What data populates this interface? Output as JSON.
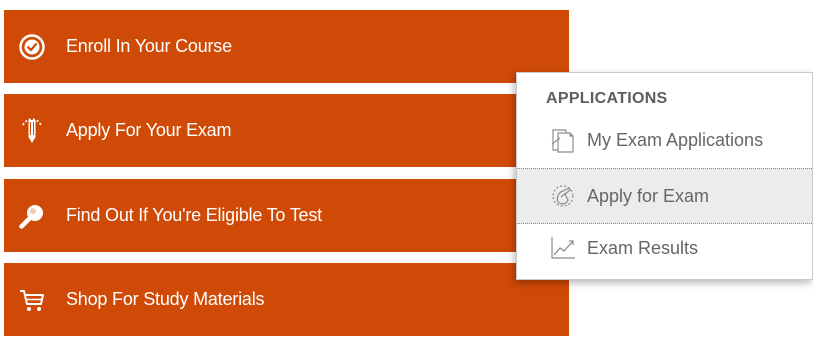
{
  "colors": {
    "button_bg": "#cf4a07",
    "button_text": "#ffffff",
    "menu_text": "#666666",
    "menu_heading": "#5e5e5e",
    "menu_hover_bg": "#ececec"
  },
  "actions": [
    {
      "label": "Enroll In Your Course",
      "icon": "check-circle-icon"
    },
    {
      "label": "Apply For Your Exam",
      "icon": "pencil-icon"
    },
    {
      "label": "Find Out If You're Eligible To Test",
      "icon": "magnifier-icon"
    },
    {
      "label": "Shop For Study Materials",
      "icon": "shopping-cart-icon"
    }
  ],
  "menu": {
    "heading": "APPLICATIONS",
    "items": [
      {
        "label": "My Exam Applications",
        "icon": "documents-icon"
      },
      {
        "label": "Apply for Exam",
        "icon": "hand-pen-icon",
        "highlighted": true
      },
      {
        "label": "Exam Results",
        "icon": "line-chart-icon"
      }
    ]
  }
}
